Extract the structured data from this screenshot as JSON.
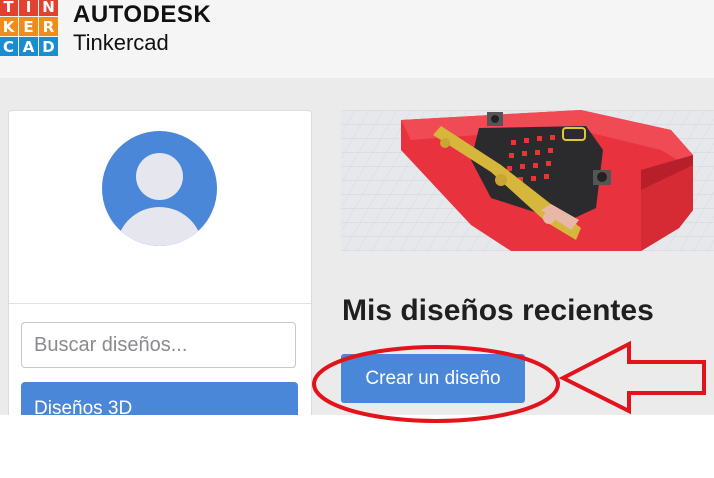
{
  "header": {
    "logo_letters": [
      "T",
      "I",
      "N",
      "K",
      "E",
      "R",
      "C",
      "A",
      "D"
    ],
    "logo_colors": [
      "#e2412f",
      "#e2412f",
      "#e2412f",
      "#ef8c1e",
      "#ef8c1e",
      "#ef8c1e",
      "#1a8dd1",
      "#1a8dd1",
      "#1a8dd1"
    ],
    "brand_company": "AUTODESK",
    "brand_product": "Tinkercad"
  },
  "sidebar": {
    "search_placeholder": "Buscar diseños...",
    "nav_items": [
      {
        "label": "Diseños 3D",
        "active": true
      }
    ]
  },
  "main": {
    "section_title": "Mis diseños recientes",
    "create_button_label": "Crear un diseño"
  },
  "colors": {
    "accent": "#4a87d9",
    "annotation": "#e3131b",
    "banner_board": "#e8323d"
  },
  "icons": {
    "avatar": "default-user-icon"
  }
}
